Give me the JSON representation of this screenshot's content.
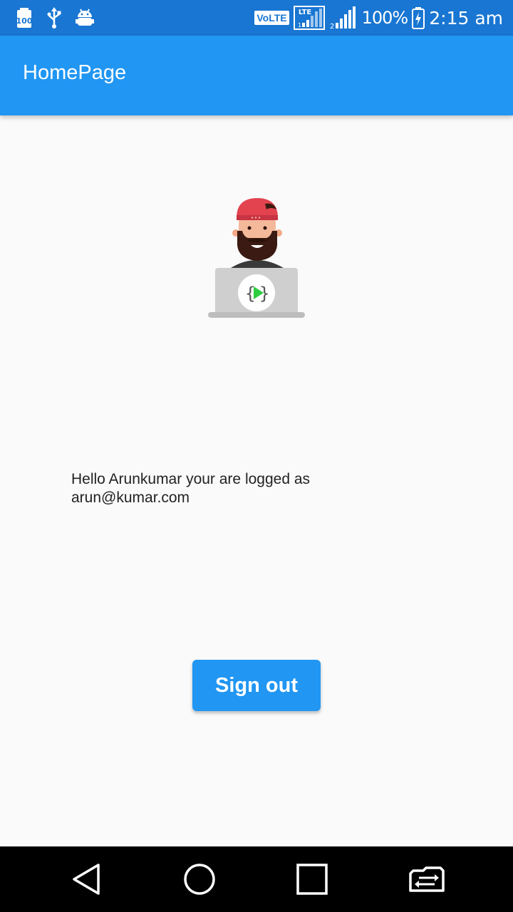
{
  "status_bar": {
    "left_icons": [
      "battery-100-notification-icon",
      "usb-icon",
      "android-debug-icon"
    ],
    "volte_label": "VoLTE",
    "lte_label": "LTE",
    "battery_percent": "100%",
    "time": "2:15 am"
  },
  "app_bar": {
    "title": "HomePage"
  },
  "main": {
    "avatar_icon": "developer-avatar-icon",
    "greeting": "Hello Arunkumar your are logged as arun@kumar.com",
    "sign_out_label": "Sign out"
  },
  "nav_bar": {
    "buttons": [
      "back-icon",
      "home-icon",
      "recents-icon",
      "switch-app-icon"
    ]
  },
  "colors": {
    "status_bar": "#1976d2",
    "app_bar": "#2196f3",
    "button": "#2196f3",
    "background": "#fafafa"
  }
}
